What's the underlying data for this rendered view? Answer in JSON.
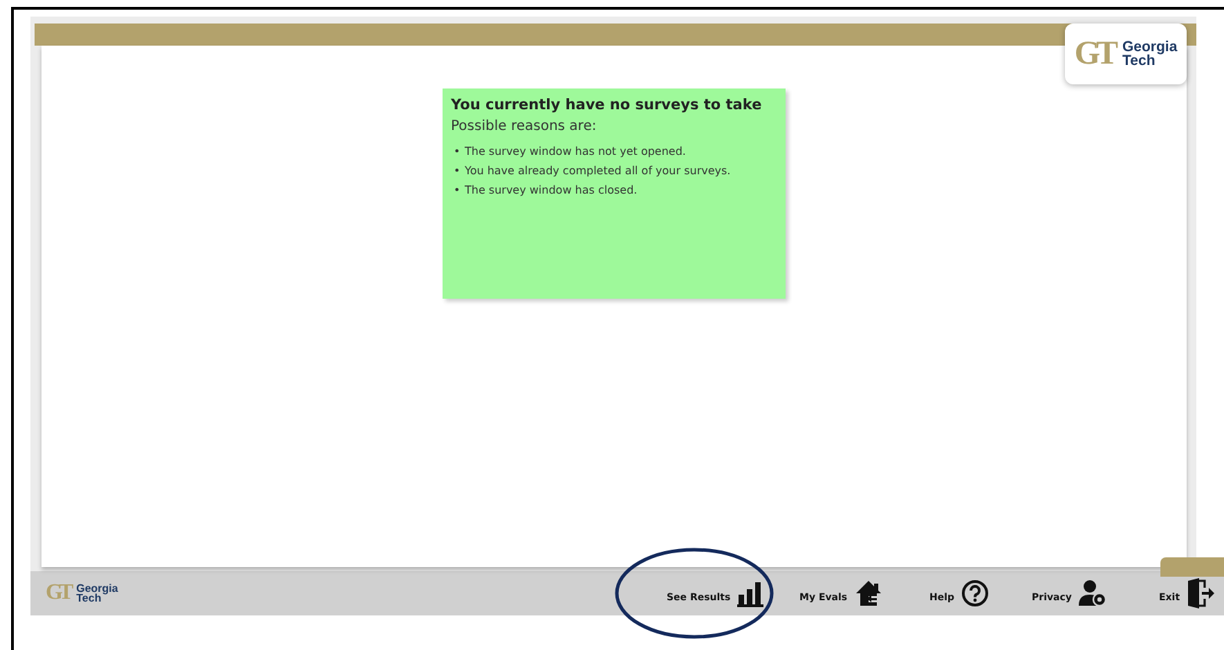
{
  "header": {
    "logo": {
      "mark": "GT",
      "name_line_1": "Georgia",
      "name_line_2": "Tech"
    }
  },
  "notice": {
    "title": "You currently have no surveys to take",
    "subtitle": "Possible reasons are:",
    "reasons": [
      {
        "bullet": "•",
        "text": "The survey window has not yet opened."
      },
      {
        "bullet": "•",
        "text": "You have already completed all of your surveys."
      },
      {
        "bullet": "•",
        "text": "The survey window has closed."
      }
    ]
  },
  "footer": {
    "logo": {
      "mark": "GT",
      "name_line_1": "Georgia",
      "name_line_2": "Tech"
    },
    "nav": [
      {
        "label": "See Results",
        "kind": "results"
      },
      {
        "label": "My Evals",
        "kind": "home"
      },
      {
        "label": "Help",
        "kind": "help"
      },
      {
        "label": "Privacy",
        "kind": "privacy"
      },
      {
        "label": "Exit",
        "kind": "exit"
      }
    ]
  }
}
